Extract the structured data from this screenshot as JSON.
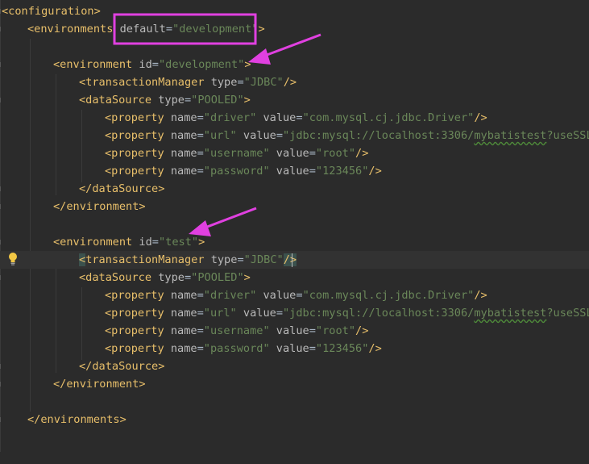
{
  "editor": {
    "lines": [
      {
        "parts": [
          [
            "tag",
            "<configuration>"
          ]
        ]
      },
      {
        "parts": [
          [
            "tag",
            "<environments "
          ],
          [
            "attr",
            "default"
          ],
          [
            "eq",
            "="
          ],
          [
            "val",
            "\"development\""
          ],
          [
            "tag",
            ">"
          ]
        ]
      },
      {
        "parts": []
      },
      {
        "parts": [
          [
            "tag",
            "<environment "
          ],
          [
            "attr",
            "id"
          ],
          [
            "eq",
            "="
          ],
          [
            "val",
            "\"development\""
          ],
          [
            "tag",
            ">"
          ]
        ]
      },
      {
        "parts": [
          [
            "tag",
            "<transactionManager "
          ],
          [
            "attr",
            "type"
          ],
          [
            "eq",
            "="
          ],
          [
            "val",
            "\"JDBC\""
          ],
          [
            "tag",
            "/>"
          ]
        ]
      },
      {
        "parts": [
          [
            "tag",
            "<dataSource "
          ],
          [
            "attr",
            "type"
          ],
          [
            "eq",
            "="
          ],
          [
            "val",
            "\"POOLED\""
          ],
          [
            "tag",
            ">"
          ]
        ]
      },
      {
        "parts": [
          [
            "tag",
            "<property "
          ],
          [
            "attr",
            "name"
          ],
          [
            "eq",
            "="
          ],
          [
            "val",
            "\"driver\""
          ],
          [
            "attr",
            " value"
          ],
          [
            "eq",
            "="
          ],
          [
            "val",
            "\"com.mysql.cj.jdbc.Driver\""
          ],
          [
            "tag",
            "/>"
          ]
        ]
      },
      {
        "parts": [
          [
            "tag",
            "<property "
          ],
          [
            "attr",
            "name"
          ],
          [
            "eq",
            "="
          ],
          [
            "val",
            "\"url\""
          ],
          [
            "attr",
            " value"
          ],
          [
            "eq",
            "="
          ],
          [
            "val",
            "\"jdbc:mysql://localhost:3306/"
          ],
          [
            "valw",
            "mybatistest"
          ],
          [
            "val",
            "?useSSL="
          ]
        ]
      },
      {
        "parts": [
          [
            "tag",
            "<property "
          ],
          [
            "attr",
            "name"
          ],
          [
            "eq",
            "="
          ],
          [
            "val",
            "\"username\""
          ],
          [
            "attr",
            " value"
          ],
          [
            "eq",
            "="
          ],
          [
            "val",
            "\"root\""
          ],
          [
            "tag",
            "/>"
          ]
        ]
      },
      {
        "parts": [
          [
            "tag",
            "<property "
          ],
          [
            "attr",
            "name"
          ],
          [
            "eq",
            "="
          ],
          [
            "val",
            "\"password\""
          ],
          [
            "attr",
            " value"
          ],
          [
            "eq",
            "="
          ],
          [
            "val",
            "\"123456\""
          ],
          [
            "tag",
            "/>"
          ]
        ]
      },
      {
        "parts": [
          [
            "tag",
            "</dataSource>"
          ]
        ]
      },
      {
        "parts": [
          [
            "tag",
            "</environment>"
          ]
        ]
      },
      {
        "parts": []
      },
      {
        "parts": [
          [
            "tag",
            "<environment "
          ],
          [
            "attr",
            "id"
          ],
          [
            "eq",
            "="
          ],
          [
            "val",
            "\"test\""
          ],
          [
            "tag",
            ">"
          ]
        ]
      },
      {
        "parts": [
          [
            "caret",
            "<"
          ],
          [
            "tag",
            "transactionManager "
          ],
          [
            "attr",
            "type"
          ],
          [
            "eq",
            "="
          ],
          [
            "val",
            "\"JDBC\""
          ],
          [
            "caret",
            "/>"
          ]
        ]
      },
      {
        "parts": [
          [
            "tag",
            "<dataSource "
          ],
          [
            "attr",
            "type"
          ],
          [
            "eq",
            "="
          ],
          [
            "val",
            "\"POOLED\""
          ],
          [
            "tag",
            ">"
          ]
        ]
      },
      {
        "parts": [
          [
            "tag",
            "<property "
          ],
          [
            "attr",
            "name"
          ],
          [
            "eq",
            "="
          ],
          [
            "val",
            "\"driver\""
          ],
          [
            "attr",
            " value"
          ],
          [
            "eq",
            "="
          ],
          [
            "val",
            "\"com.mysql.cj.jdbc.Driver\""
          ],
          [
            "tag",
            "/>"
          ]
        ]
      },
      {
        "parts": [
          [
            "tag",
            "<property "
          ],
          [
            "attr",
            "name"
          ],
          [
            "eq",
            "="
          ],
          [
            "val",
            "\"url\""
          ],
          [
            "attr",
            " value"
          ],
          [
            "eq",
            "="
          ],
          [
            "val",
            "\"jdbc:mysql://localhost:3306/"
          ],
          [
            "valw",
            "mybatistest"
          ],
          [
            "val",
            "?useSSL="
          ]
        ]
      },
      {
        "parts": [
          [
            "tag",
            "<property "
          ],
          [
            "attr",
            "name"
          ],
          [
            "eq",
            "="
          ],
          [
            "val",
            "\"username\""
          ],
          [
            "attr",
            " value"
          ],
          [
            "eq",
            "="
          ],
          [
            "val",
            "\"root\""
          ],
          [
            "tag",
            "/>"
          ]
        ]
      },
      {
        "parts": [
          [
            "tag",
            "<property "
          ],
          [
            "attr",
            "name"
          ],
          [
            "eq",
            "="
          ],
          [
            "val",
            "\"password\""
          ],
          [
            "attr",
            " value"
          ],
          [
            "eq",
            "="
          ],
          [
            "val",
            "\"123456\""
          ],
          [
            "tag",
            "/>"
          ]
        ]
      },
      {
        "parts": [
          [
            "tag",
            "</dataSource>"
          ]
        ]
      },
      {
        "parts": [
          [
            "tag",
            "</environment>"
          ]
        ]
      },
      {
        "parts": []
      },
      {
        "parts": [
          [
            "tag",
            "</environments>"
          ]
        ]
      }
    ],
    "current_line_index": 14
  },
  "annotations": {
    "highlight_color": "#e040e0",
    "boxed_text": "default=\"development\""
  },
  "icons": {
    "intention": "lightbulb-icon"
  },
  "colors": {
    "background": "#2b2b2b",
    "tag": "#e8bf6a",
    "attribute": "#bababa",
    "value": "#6a8759",
    "annotation": "#e040e0"
  }
}
